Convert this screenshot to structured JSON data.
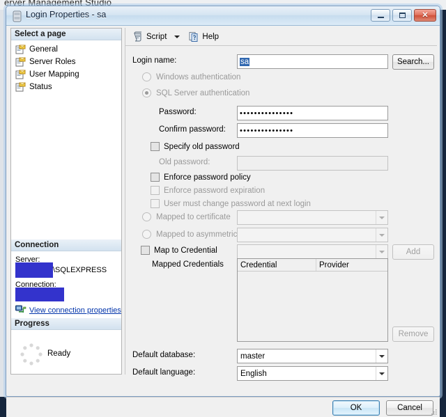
{
  "background": {
    "app_text": "erver Management Studio"
  },
  "window": {
    "title": "Login Properties - sa",
    "icon": "server-icon",
    "controls": {
      "minimize": "minimize-icon",
      "maximize": "maximize-icon",
      "close": "close-icon",
      "close_glyph": "✕"
    }
  },
  "sidebar": {
    "select_page_header": "Select a page",
    "items": [
      {
        "label": "General",
        "icon": "page-icon"
      },
      {
        "label": "Server Roles",
        "icon": "page-icon"
      },
      {
        "label": "User Mapping",
        "icon": "page-icon"
      },
      {
        "label": "Status",
        "icon": "page-icon"
      }
    ],
    "connection": {
      "header": "Connection",
      "server_label": "Server:",
      "server_value": "\\SQLEXPRESS",
      "connection_label": "Connection:",
      "connection_value": "",
      "view_properties_link": "View connection properties",
      "link_icon": "connection-icon"
    },
    "progress": {
      "header": "Progress",
      "status": "Ready",
      "spinner": "spinner-icon"
    }
  },
  "toolbar": {
    "script_label": "Script",
    "script_icon": "script-icon",
    "script_caret": "chevron-down-icon",
    "help_label": "Help",
    "help_icon": "help-icon"
  },
  "form": {
    "login_name_label": "Login name:",
    "login_name_value": "sa",
    "search_button": "Search...",
    "windows_auth_label": "Windows authentication",
    "sql_auth_label": "SQL Server authentication",
    "auth_selected": "sql",
    "password_label": "Password:",
    "password_value": "•••••••••••••••",
    "confirm_password_label": "Confirm password:",
    "confirm_password_value": "•••••••••••••••",
    "specify_old_password_label": "Specify old password",
    "old_password_label": "Old password:",
    "old_password_value": "",
    "enforce_policy_label": "Enforce password policy",
    "enforce_expiration_label": "Enforce password expiration",
    "must_change_label": "User must change password at next login",
    "mapped_certificate_label": "Mapped to certificate",
    "mapped_certificate_value": "",
    "mapped_asymmetric_label": "Mapped to asymmetric key",
    "mapped_asymmetric_value": "",
    "map_credential_label": "Map to Credential",
    "map_credential_value": "",
    "add_button": "Add",
    "mapped_credentials_label": "Mapped Credentials",
    "credentials_columns": [
      "Credential",
      "Provider"
    ],
    "credentials_rows": [],
    "remove_button": "Remove",
    "default_database_label": "Default database:",
    "default_database_value": "master",
    "default_language_label": "Default language:",
    "default_language_value": "English"
  },
  "footer": {
    "ok_button": "OK",
    "cancel_button": "Cancel",
    "resize_grip": "resize-grip-icon"
  },
  "colors": {
    "accent": "#3168b0",
    "redaction": "#3333cc",
    "link": "#0033aa",
    "dialog_bg": "#f0f0f0"
  }
}
